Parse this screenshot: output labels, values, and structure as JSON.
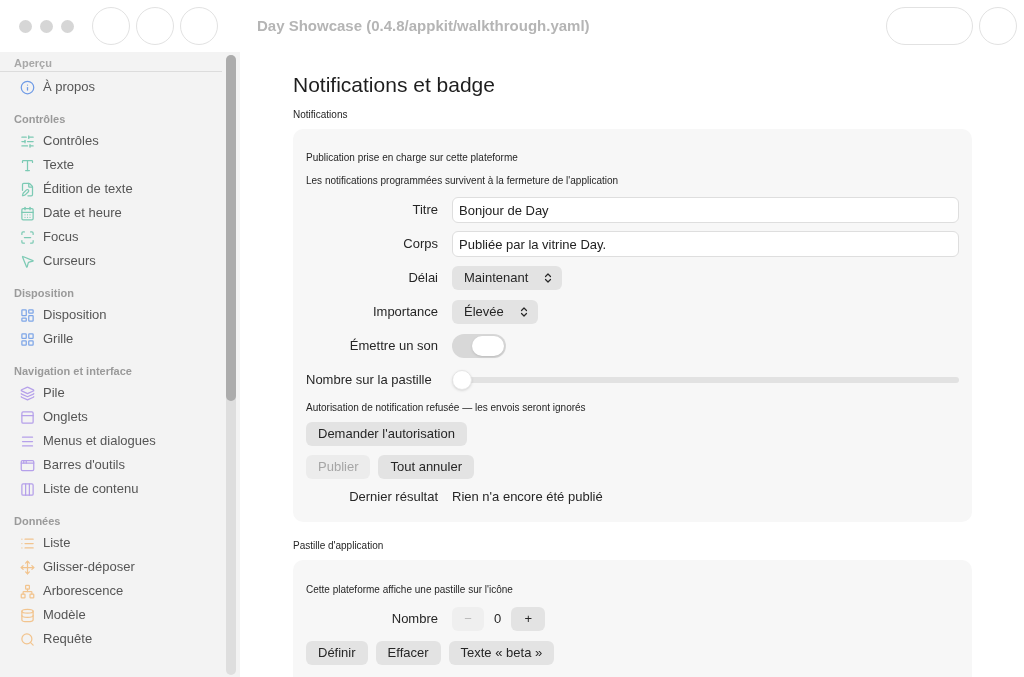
{
  "window": {
    "title": "Day Showcase (0.4.8/appkit/walkthrough.yaml)"
  },
  "sidebar": {
    "sections": [
      {
        "title": "Aperçu",
        "items": [
          {
            "label": "À propos"
          }
        ]
      },
      {
        "title": "Contrôles",
        "items": [
          {
            "label": "Contrôles"
          },
          {
            "label": "Texte"
          },
          {
            "label": "Édition de texte"
          },
          {
            "label": "Date et heure"
          },
          {
            "label": "Focus"
          },
          {
            "label": "Curseurs"
          }
        ]
      },
      {
        "title": "Disposition",
        "items": [
          {
            "label": "Disposition"
          },
          {
            "label": "Grille"
          }
        ]
      },
      {
        "title": "Navigation et interface",
        "items": [
          {
            "label": "Pile"
          },
          {
            "label": "Onglets"
          },
          {
            "label": "Menus et dialogues"
          },
          {
            "label": "Barres d'outils"
          },
          {
            "label": "Liste de contenu"
          }
        ]
      },
      {
        "title": "Données",
        "items": [
          {
            "label": "Liste"
          },
          {
            "label": "Glisser-déposer"
          },
          {
            "label": "Arborescence"
          },
          {
            "label": "Modèle"
          },
          {
            "label": "Requête"
          }
        ]
      }
    ]
  },
  "page": {
    "title": "Notifications et badge"
  },
  "notifications": {
    "heading": "Notifications",
    "notes": [
      "Publication prise en charge sur cette plateforme",
      "Les notifications programmées survivent à la fermeture de l'application"
    ],
    "fields": [
      {
        "kind": "text",
        "label": "Titre",
        "value": "Bonjour de Day"
      },
      {
        "kind": "text",
        "label": "Corps",
        "value": "Publiée par la vitrine Day."
      },
      {
        "kind": "select",
        "label": "Délai",
        "value": "Maintenant"
      },
      {
        "kind": "select",
        "label": "Importance",
        "value": "Élevée"
      },
      {
        "kind": "toggle",
        "label": "Émettre un son",
        "on": true
      },
      {
        "kind": "slider",
        "label": "Nombre sur la pastille",
        "level": 0
      }
    ],
    "permission_note": "Autorisation de notification refusée — les envois seront ignorés",
    "request_button": "Demander l'autorisation",
    "actions": [
      {
        "label": "Publier",
        "disabled": true
      },
      {
        "label": "Tout annuler",
        "disabled": false
      }
    ],
    "result": {
      "label": "Dernier résultat",
      "value": "Rien n'a encore été publié"
    }
  },
  "badge": {
    "heading": "Pastille d'application",
    "note": "Cette plateforme affiche une pastille sur l'icône",
    "stepper": {
      "label": "Nombre",
      "value": "0",
      "decrement": "−",
      "increment": "+",
      "decrement_disabled": true
    },
    "actions": [
      {
        "label": "Définir"
      },
      {
        "label": "Effacer"
      },
      {
        "label": "Texte « beta »"
      }
    ]
  }
}
